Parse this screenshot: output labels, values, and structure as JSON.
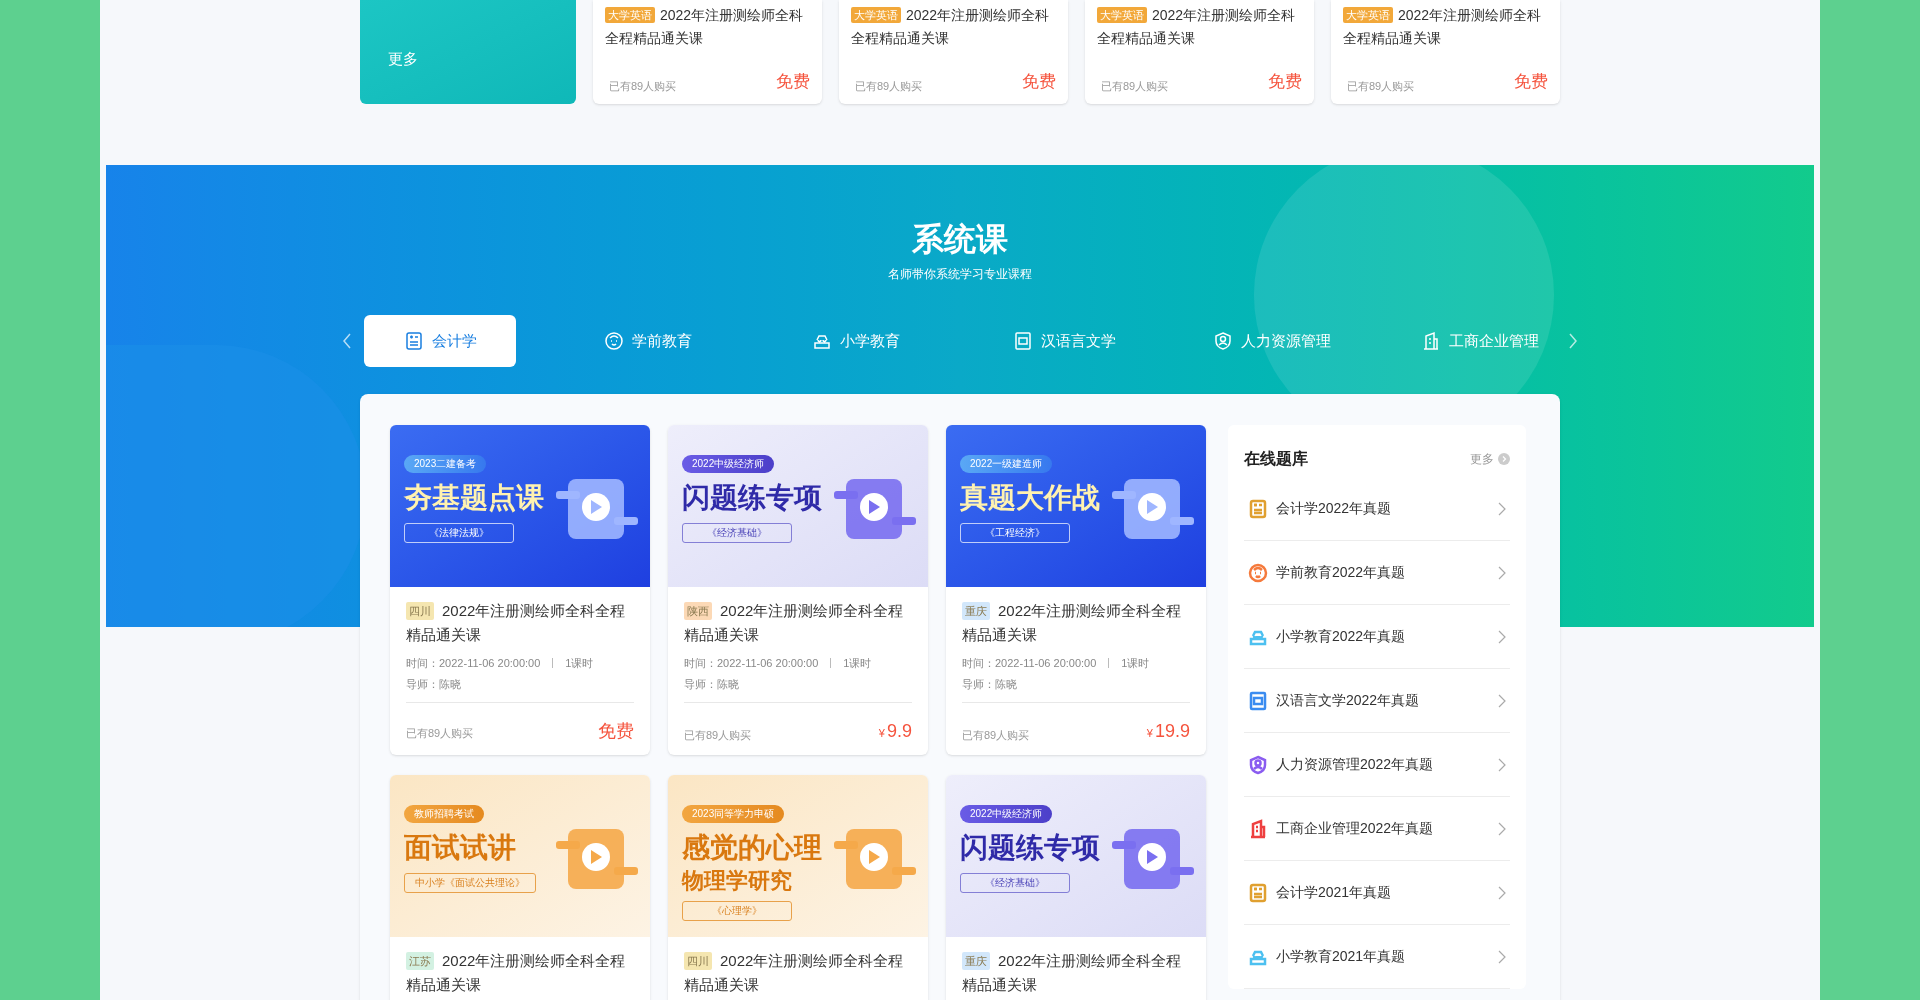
{
  "top_courses": {
    "more_label": "更多",
    "cards": [
      {
        "tag": "大学英语",
        "title": "2022年注册测绘师全科全程精品通关课",
        "buyers": "已有89人购买",
        "price": "免费"
      },
      {
        "tag": "大学英语",
        "title": "2022年注册测绘师全科全程精品通关课",
        "buyers": "已有89人购买",
        "price": "免费"
      },
      {
        "tag": "大学英语",
        "title": "2022年注册测绘师全科全程精品通关课",
        "buyers": "已有89人购买",
        "price": "免费"
      },
      {
        "tag": "大学英语",
        "title": "2022年注册测绘师全科全程精品通关课",
        "buyers": "已有89人购买",
        "price": "免费"
      }
    ]
  },
  "section": {
    "title": "系统课",
    "subtitle": "名师带你系统学习专业课程"
  },
  "tabs": [
    {
      "label": "会计学",
      "selected": true
    },
    {
      "label": "学前教育",
      "selected": false
    },
    {
      "label": "小学教育",
      "selected": false
    },
    {
      "label": "汉语言文学",
      "selected": false
    },
    {
      "label": "人力资源管理",
      "selected": false
    },
    {
      "label": "工商企业管理",
      "selected": false
    }
  ],
  "courses": [
    {
      "banner": {
        "kind": "blue",
        "badge": "2023二建备考",
        "headline": [
          "夯基题点课"
        ],
        "book": "《法律法规》"
      },
      "region": "四川",
      "color": "#f5e6b0",
      "title": "2022年注册测绘师全科全程精品通关课",
      "time": "时间：2022-11-06 20:00:00",
      "lessons": "1课时",
      "teacher": "导师：陈晓",
      "buyers": "已有89人购买",
      "price": "免费"
    },
    {
      "banner": {
        "kind": "lavender",
        "badge": "2022中级经济师",
        "headline": [
          "闪题练专项"
        ],
        "book": "《经济基础》"
      },
      "region": "陕西",
      "color": "#fcd9b6",
      "title": "2022年注册测绘师全科全程精品通关课",
      "time": "时间：2022-11-06 20:00:00",
      "lessons": "1课时",
      "teacher": "导师：陈晓",
      "buyers": "已有89人购买",
      "currency": "¥",
      "price": "9.9"
    },
    {
      "banner": {
        "kind": "blue",
        "badge": "2022一级建造师",
        "headline": [
          "真题大作战"
        ],
        "book": "《工程经济》"
      },
      "region": "重庆",
      "color": "#d2e7fb",
      "title": "2022年注册测绘师全科全程精品通关课",
      "time": "时间：2022-11-06 20:00:00",
      "lessons": "1课时",
      "teacher": "导师：陈晓",
      "buyers": "已有89人购买",
      "currency": "¥",
      "price": "19.9"
    },
    {
      "banner": {
        "kind": "orange",
        "badge": "教师招聘考试",
        "headline": [
          "面试试讲"
        ],
        "book": "中小学《面试公共理论》"
      },
      "region": "江苏",
      "color": "#d3f1e2",
      "title": "2022年注册测绘师全科全程精品通关课"
    },
    {
      "banner": {
        "kind": "orange",
        "badge": "2023同等学力申硕",
        "headline": [
          "感觉的心理",
          "物理学研究"
        ],
        "book": "《心理学》"
      },
      "region": "四川",
      "color": "#f5e6b0",
      "title": "2022年注册测绘师全科全程精品通关课"
    },
    {
      "banner": {
        "kind": "lavender",
        "badge": "2022中级经济师",
        "headline": [
          "闪题练专项"
        ],
        "book": "《经济基础》"
      },
      "region": "重庆",
      "color": "#d2e7fb",
      "title": "2022年注册测绘师全科全程精品通关课"
    }
  ],
  "question_bank": {
    "title": "在线题库",
    "more": "更多",
    "items": [
      {
        "label": "会计学2022年真题",
        "color": "#e0a030"
      },
      {
        "label": "学前教育2022年真题",
        "color": "#f57a3c"
      },
      {
        "label": "小学教育2022年真题",
        "color": "#4cc0f0"
      },
      {
        "label": "汉语言文学2022年真题",
        "color": "#3b8cf0"
      },
      {
        "label": "人力资源管理2022年真题",
        "color": "#8a5cf0"
      },
      {
        "label": "工商企业管理2022年真题",
        "color": "#ee4040"
      },
      {
        "label": "会计学2021年真题",
        "color": "#e0a030"
      },
      {
        "label": "小学教育2021年真题",
        "color": "#4cc0f0"
      }
    ]
  }
}
